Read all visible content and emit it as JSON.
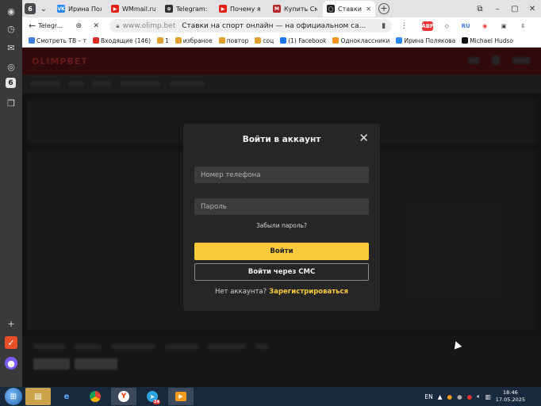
{
  "sidebar": {
    "badge": "6"
  },
  "tabs": {
    "count": "6",
    "items": [
      {
        "label": "Ирина Поля",
        "color": "#2787f5",
        "glyph": "VK"
      },
      {
        "label": "WMmail.ru",
        "color": "#e62117",
        "glyph": "▶"
      },
      {
        "label": "Telegram: Vi",
        "color": "#333333",
        "glyph": "⊕"
      },
      {
        "label": "Почему я вы",
        "color": "#e62117",
        "glyph": "▶"
      },
      {
        "label": "Купить Смар",
        "color": "#b3262d",
        "glyph": "M"
      },
      {
        "label": "Ставки на",
        "color": "#222222",
        "glyph": "◯",
        "active": true
      }
    ]
  },
  "address": {
    "page_title": "Telegr...",
    "host": "www.olimp.bet",
    "title": "Ставки на спорт онлайн — на официальном са..."
  },
  "extensions": [
    "ABP",
    "◇",
    "RU",
    "◉",
    "▣",
    "⇩"
  ],
  "bookmarks": [
    {
      "label": "Смотреть ТВ – т",
      "color": "#3d7ee0"
    },
    {
      "label": "Входящие (146)",
      "color": "#d93025"
    },
    {
      "label": "1",
      "color": "#e0a030"
    },
    {
      "label": "избраное",
      "color": "#e0a030"
    },
    {
      "label": "повтор",
      "color": "#e0a030"
    },
    {
      "label": "соц",
      "color": "#e0a030"
    },
    {
      "label": "(1) Facebook",
      "color": "#1877f2"
    },
    {
      "label": "Одноклассники",
      "color": "#f7931e"
    },
    {
      "label": "Ирина Полякова",
      "color": "#2787f5"
    },
    {
      "label": "Michael Hudso",
      "color": "#111111"
    }
  ],
  "site": {
    "logo": "OLIMPBET"
  },
  "modal": {
    "title": "Войти в аккаунт",
    "phone_placeholder": "Номер телефона",
    "password_placeholder": "Пароль",
    "forgot": "Забыли пароль?",
    "login_button": "Войти",
    "sms_button": "Войти через СМС",
    "no_account": "Нет аккаунта?",
    "register": "Зарегистрироваться"
  },
  "taskbar": {
    "lang": "EN",
    "telegram_badge": "24",
    "time": "18:46",
    "date": "17.05.2025"
  }
}
